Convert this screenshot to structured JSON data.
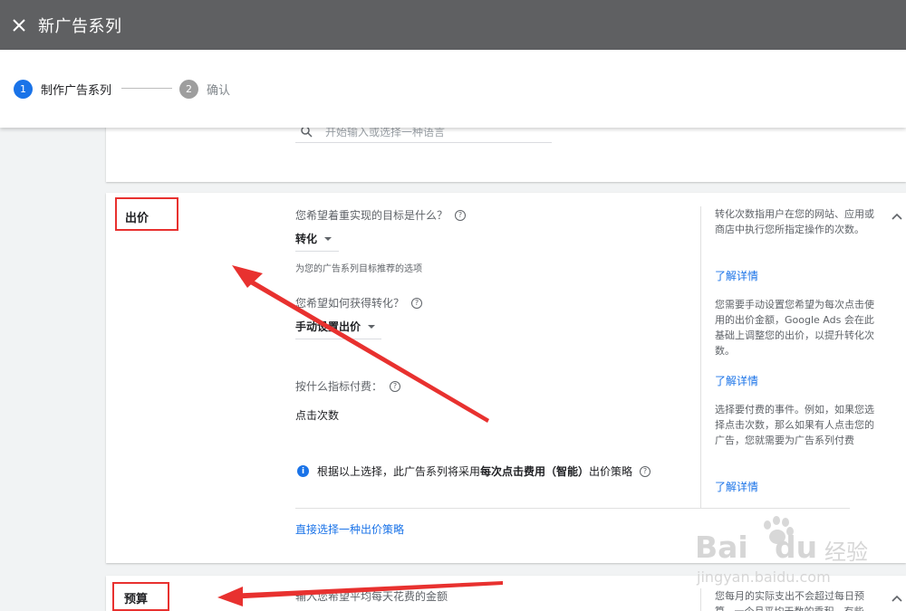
{
  "appbar": {
    "title": "新广告系列"
  },
  "stepper": {
    "steps": [
      {
        "number": "1",
        "label": "制作广告系列",
        "active": true
      },
      {
        "number": "2",
        "label": "确认",
        "active": false
      }
    ]
  },
  "language_search": {
    "placeholder": "开始输入或选择一种语言"
  },
  "bidding": {
    "title": "出价",
    "goal_question": "您希望着重实现的目标是什么？",
    "goal_value": "转化",
    "goal_hint": "为您的广告系列目标推荐的选项",
    "how_question": "您希望如何获得转化？",
    "how_value": "手动设置出价",
    "pay_question": "按什么指标付费：",
    "pay_value": "点击次数",
    "info_prefix": "根据以上选择，此广告系列将采用",
    "info_strategy": "每次点击费用（智能）",
    "info_suffix": "出价策略",
    "direct_link": "直接选择一种出价策略",
    "side": [
      {
        "text": "转化次数指用户在您的网站、应用或商店中执行您所指定操作的次数。",
        "link": "了解详情"
      },
      {
        "text": "您需要手动设置您希望为每次点击使用的出价金额，Google Ads 会在此基础上调整您的出价，以提升转化次数。",
        "link": "了解详情"
      },
      {
        "text": "选择要付费的事件。例如，如果您选择点击次数，那么如果有人点击您的广告，您就需要为广告系列付费",
        "link": "了解详情"
      }
    ]
  },
  "budget": {
    "title": "预算",
    "question": "输入您希望平均每天花费的金额",
    "side_text": "您每月的实际支出不会超过每日预算...一个月平均天数的乘积，有些"
  },
  "watermark": {
    "brand": "Bai",
    "brand2": "du",
    "jy": "经验",
    "url": "jingyan.baidu.com"
  },
  "colors": {
    "appbar": "#5f6062",
    "accent": "#1a73e8",
    "annotation": "#e8312f"
  }
}
